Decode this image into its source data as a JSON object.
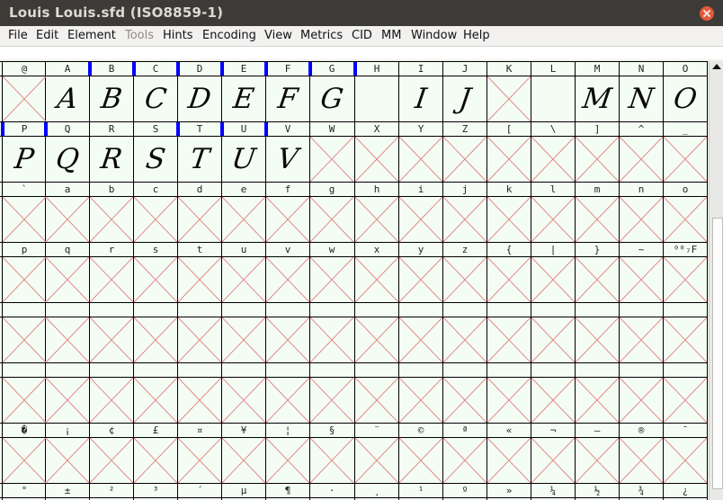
{
  "window": {
    "title": "Louis  Louis.sfd (ISO8859-1)"
  },
  "menu": [
    "File",
    "Edit",
    "Element",
    "Tools",
    "Hints",
    "Encoding",
    "View",
    "Metrics",
    "CID",
    "MM",
    "Window",
    "Help"
  ],
  "rows": [
    {
      "labels": [
        "@",
        "A",
        "B",
        "C",
        "D",
        "E",
        "F",
        "G",
        "H",
        "I",
        "J",
        "K",
        "L",
        "M",
        "N",
        "O"
      ],
      "glyphs": [
        null,
        "A",
        "B",
        "C",
        "D",
        "E",
        "F",
        "G",
        "",
        "I",
        "J",
        null,
        "",
        "M",
        "N",
        "O"
      ],
      "selected": [
        false,
        false,
        true,
        true,
        true,
        true,
        true,
        true,
        true,
        false,
        false,
        false,
        false,
        false,
        false,
        false
      ]
    },
    {
      "labels": [
        "P",
        "Q",
        "R",
        "S",
        "T",
        "U",
        "V",
        "W",
        "X",
        "Y",
        "Z",
        "[",
        "\\",
        "]",
        "^",
        "_"
      ],
      "glyphs": [
        "P",
        "Q",
        "R",
        "S",
        "T",
        "U",
        "V",
        null,
        null,
        null,
        null,
        null,
        null,
        null,
        null,
        null
      ],
      "selected": [
        true,
        true,
        false,
        false,
        true,
        true,
        true,
        false,
        false,
        false,
        false,
        false,
        false,
        false,
        false,
        false
      ]
    },
    {
      "labels": [
        "`",
        "a",
        "b",
        "c",
        "d",
        "e",
        "f",
        "g",
        "h",
        "i",
        "j",
        "k",
        "l",
        "m",
        "n",
        "o"
      ],
      "glyphs": [
        null,
        null,
        null,
        null,
        null,
        null,
        null,
        null,
        null,
        null,
        null,
        null,
        null,
        null,
        null,
        null
      ]
    },
    {
      "labels": [
        "p",
        "q",
        "r",
        "s",
        "t",
        "u",
        "v",
        "w",
        "x",
        "y",
        "z",
        "{",
        "|",
        "}",
        "~",
        "⁰⁰₇F"
      ],
      "glyphs": [
        null,
        null,
        null,
        null,
        null,
        null,
        null,
        null,
        null,
        null,
        null,
        null,
        null,
        null,
        null,
        null
      ]
    },
    {
      "labels": [
        "",
        "",
        "",
        "",
        "",
        "",
        "",
        "",
        "",
        "",
        "",
        "",
        "",
        "",
        "",
        ""
      ],
      "glyphs": [
        null,
        null,
        null,
        null,
        null,
        null,
        null,
        null,
        null,
        null,
        null,
        null,
        null,
        null,
        null,
        null
      ]
    },
    {
      "labels": [
        "",
        "",
        "",
        "",
        "",
        "",
        "",
        "",
        "",
        "",
        "",
        "",
        "",
        "",
        "",
        ""
      ],
      "glyphs": [
        null,
        null,
        null,
        null,
        null,
        null,
        null,
        null,
        null,
        null,
        null,
        null,
        null,
        null,
        null,
        null
      ]
    },
    {
      "labels": [
        "�",
        "¡",
        "¢",
        "£",
        "¤",
        "¥",
        "¦",
        "§",
        "¨",
        "©",
        "ª",
        "«",
        "¬",
        "–",
        "®",
        "¯"
      ],
      "glyphs": [
        null,
        null,
        null,
        null,
        null,
        null,
        null,
        null,
        null,
        null,
        null,
        null,
        null,
        null,
        null,
        null
      ]
    },
    {
      "labels": [
        "°",
        "±",
        "²",
        "³",
        "´",
        "µ",
        "¶",
        "·",
        "¸",
        "¹",
        "º",
        "»",
        "¼",
        "½",
        "¾",
        "¿"
      ],
      "glyphs": []
    }
  ]
}
